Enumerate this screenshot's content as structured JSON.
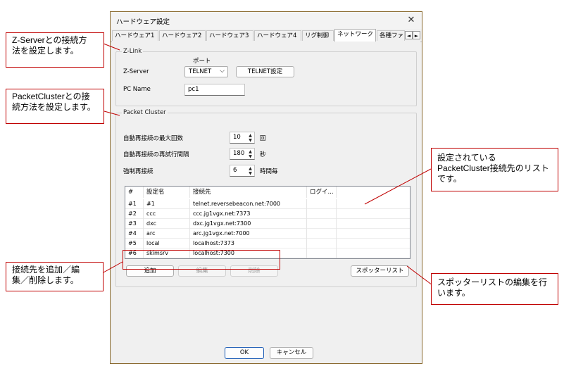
{
  "dialog": {
    "title": "ハードウェア設定",
    "close_glyph": "✕",
    "tabs": [
      "ハードウェア1",
      "ハードウェア2",
      "ハードウェア3",
      "ハードウェア4",
      "リグ制御",
      "ネットワーク",
      "各種ファ"
    ],
    "active_tab": "ネットワーク",
    "tab_scroll_left": "◄",
    "tab_scroll_right": "►"
  },
  "zlink": {
    "legend": "Z-Link",
    "port_header": "ポート",
    "zserver_label": "Z-Server",
    "port_value": "TELNET",
    "telnet_settings_button": "TELNET設定",
    "pcname_label": "PC Name",
    "pcname_value": "pc1"
  },
  "packet_cluster": {
    "legend": "Packet Cluster",
    "max_retry_label": "自動再接続の最大回数",
    "max_retry_value": "10",
    "max_retry_unit": "回",
    "retry_interval_label": "自動再接続の再試行間隔",
    "retry_interval_value": "180",
    "retry_interval_unit": "秒",
    "force_reconnect_label": "強制再接続",
    "force_reconnect_value": "6",
    "force_reconnect_unit": "時間毎",
    "columns": [
      "#",
      "設定名",
      "接続先",
      "ログイ..."
    ],
    "rows": [
      [
        "#1",
        "#1",
        "telnet.reversebeacon.net:7000",
        ""
      ],
      [
        "#2",
        "ccc",
        "ccc.jg1vgx.net:7373",
        ""
      ],
      [
        "#3",
        "dxc",
        "dxc.jg1vgx.net:7300",
        ""
      ],
      [
        "#4",
        "arc",
        "arc.jg1vgx.net:7000",
        ""
      ],
      [
        "#5",
        "local",
        "localhost:7373",
        ""
      ],
      [
        "#6",
        "skimsrv",
        "localhost:7300",
        ""
      ]
    ],
    "add_button": "追加",
    "edit_button": "編集",
    "delete_button": "削除",
    "spotter_list_button": "スポッターリスト"
  },
  "footer": {
    "ok_button": "OK",
    "cancel_button": "キャンセル"
  },
  "callouts": {
    "zserver": [
      "Z-Serverとの接続方",
      "法を設定します。"
    ],
    "packetcluster": [
      "PacketClusterとの接",
      "続方法を設定します。"
    ],
    "list": [
      "設定されている",
      "PacketCluster接続先のリスト",
      "です。"
    ],
    "addedit": [
      "接続先を追加／編",
      "集／削除します。"
    ],
    "spotter": [
      "スポッターリストの編集を行",
      "います。"
    ]
  },
  "colors": {
    "callout_border": "#c00000",
    "dialog_border": "#8a6a2f",
    "ok_border": "#1a5bb5"
  }
}
